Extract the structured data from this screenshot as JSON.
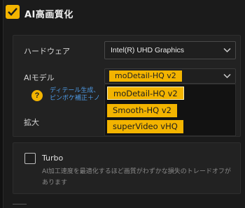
{
  "section": {
    "title": "AI高画質化",
    "enabled": true,
    "accent": "#f3b400"
  },
  "hardware": {
    "label": "ハードウェア",
    "value": "Intel(R) UHD Graphics"
  },
  "ai_model": {
    "label": "AIモデル",
    "value": "moDetail-HQ  v2",
    "options": [
      "moDetail-HQ  v2",
      "Smooth-HQ  v2",
      "superVideo vHQ"
    ]
  },
  "help": {
    "icon": "?",
    "line1": "ディテール生成、",
    "line2": "ピンボケ補正＋ノ"
  },
  "scale": {
    "label": "拡大"
  },
  "turbo": {
    "label": "Turbo",
    "checked": false,
    "description": "AI加工速度を最適化するほど画質がわずかな損失のトレードオフがあります"
  },
  "colors": {
    "link": "#4f9ce8",
    "background": "#1b1b1b",
    "panel": "#222222"
  }
}
